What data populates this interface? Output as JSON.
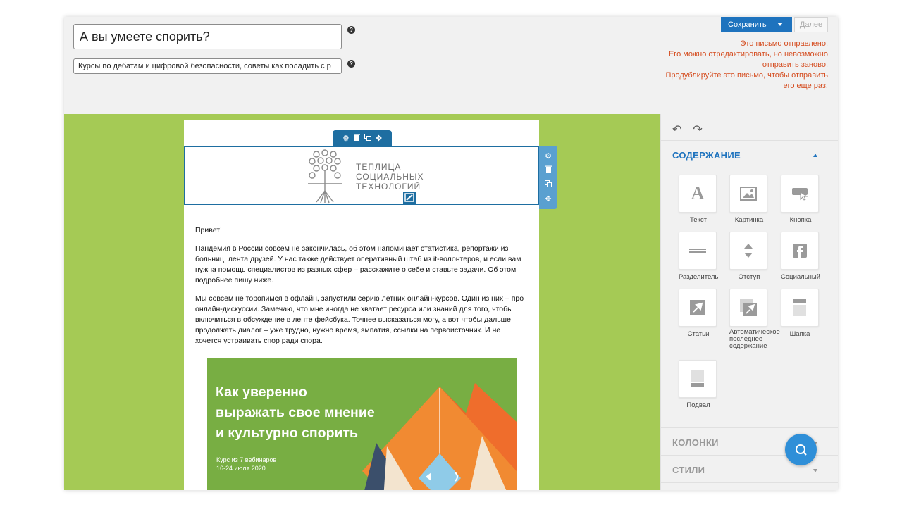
{
  "header": {
    "subject_value": "А вы умеете спорить?",
    "preheader_value": "Курсы по дебатам и цифровой безопасности, советы как поладить с р",
    "save_label": "Сохранить",
    "next_label": "Далее",
    "notice_lines": [
      "Это письмо отправлено.",
      "Его можно отредактировать, но невозможно",
      "отправить заново.",
      "Продублируйте это письмо, чтобы отправить",
      "его еще раз."
    ]
  },
  "email": {
    "logo_lines": [
      "ТЕПЛИЦА",
      "СОЦИАЛЬНЫХ",
      "ТЕХНОЛОГИЙ"
    ],
    "paragraphs": [
      "Привет!",
      "Пандемия в России совсем не закончилась, об этом напоминает статистика, репортажи из больниц, лента друзей. У нас также действует оперативный штаб из it-волонтеров, и если вам нужна помощь специалистов из разных сфер – расскажите о себе и ставьте задачи. Об этом подробнее пишу ниже.",
      "Мы совсем не торопимся в офлайн, запустили серию летних онлайн-курсов. Один из них – про онлайн-дискуссии. Замечаю, что мне иногда не хватает ресурса или знаний для того, чтобы включиться в обсуждение в ленте фейсбука. Точнее высказаться могу, а вот чтобы дальше продолжать диалог – уже трудно, нужно время, эмпатия, ссылки на первоисточник. И не хочется устраивать спор ради спора."
    ],
    "banner": {
      "title_lines": [
        "Как уверенно",
        "выражать свое мнение",
        "и культурно спорить"
      ],
      "sub_lines": [
        "Курс из 7 вебинаров",
        "16-24 июля 2020"
      ]
    }
  },
  "sidebar": {
    "content_label": "СОДЕРЖАНИЕ",
    "columns_label": "КОЛОНКИ",
    "styles_label": "СТИЛИ",
    "widgets": [
      {
        "label": "Текст",
        "icon": "text-icon"
      },
      {
        "label": "Картинка",
        "icon": "image-icon"
      },
      {
        "label": "Кнопка",
        "icon": "button-icon"
      },
      {
        "label": "Разделитель",
        "icon": "divider-icon"
      },
      {
        "label": "Отступ",
        "icon": "spacer-icon"
      },
      {
        "label": "Социальный",
        "icon": "facebook-icon"
      },
      {
        "label": "Статьи",
        "icon": "posts-icon"
      },
      {
        "label": "Автоматическое последнее содержание",
        "icon": "auto-posts-icon"
      },
      {
        "label": "Шапка",
        "icon": "header-icon"
      },
      {
        "label": "Подвал",
        "icon": "footer-icon"
      }
    ]
  },
  "colors": {
    "accent": "#1e73be",
    "canvas_bg": "#a5ca55",
    "notice": "#d54e21",
    "banner_green": "#78ae43",
    "banner_orange": "#f08a30"
  }
}
